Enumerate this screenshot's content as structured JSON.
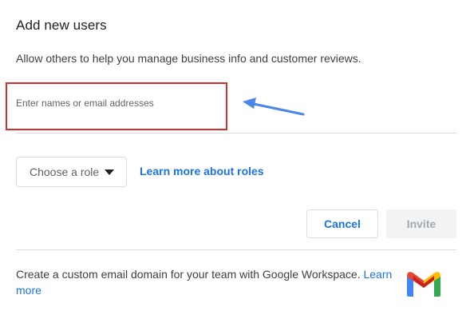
{
  "dialog": {
    "title": "Add new users",
    "description": "Allow others to help you manage business info and customer reviews."
  },
  "users_field": {
    "placeholder": "Enter names or email addresses",
    "value": ""
  },
  "annotation": {
    "highlight_color": "#d32f2f",
    "arrow_color": "#4a86e8"
  },
  "role": {
    "selected_label": "Choose a role",
    "caret_icon": "caret-down-icon",
    "learn_more_label": "Learn more about roles"
  },
  "actions": {
    "cancel_label": "Cancel",
    "invite_label": "Invite",
    "invite_disabled": true
  },
  "workspace": {
    "text": "Create a custom email domain for your team with Google Workspace.",
    "link_label": "Learn more",
    "logo_icon": "gmail-icon"
  },
  "colors": {
    "accent": "#1a73e8",
    "divider": "#dadce0",
    "text_primary": "#202124",
    "text_secondary": "#3c4043"
  }
}
